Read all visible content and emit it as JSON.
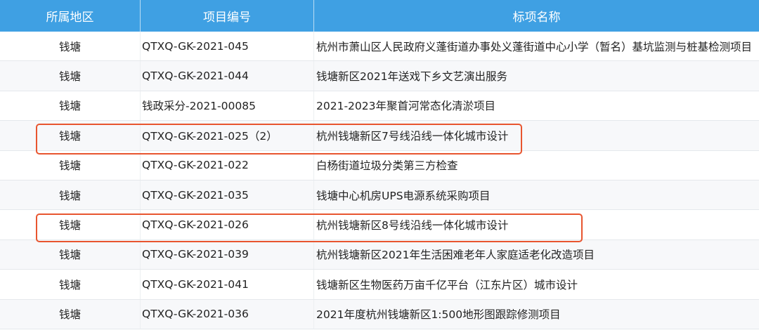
{
  "headers": {
    "region": "所属地区",
    "code": "项目编号",
    "name": "标项名称"
  },
  "rows": [
    {
      "region": "钱塘",
      "code": "QTXQ-GK-2021-045",
      "name": "杭州市萧山区人民政府义蓬街道办事处义蓬街道中心小学（暂名）基坑监测与桩基检测项目"
    },
    {
      "region": "钱塘",
      "code": "QTXQ-GK-2021-044",
      "name": "钱塘新区2021年送戏下乡文艺演出服务"
    },
    {
      "region": "钱塘",
      "code": "钱政采分-2021-00085",
      "name": "2021-2023年聚首河常态化清淤项目"
    },
    {
      "region": "钱塘",
      "code": "QTXQ-GK-2021-025（2）",
      "name": "杭州钱塘新区7号线沿线一体化城市设计",
      "highlighted": true
    },
    {
      "region": "钱塘",
      "code": "QTXQ-GK-2021-022",
      "name": "白杨街道垃圾分类第三方检查"
    },
    {
      "region": "钱塘",
      "code": "QTXQ-GK-2021-035",
      "name": "钱塘中心机房UPS电源系统采购项目"
    },
    {
      "region": "钱塘",
      "code": "QTXQ-GK-2021-026",
      "name": "杭州钱塘新区8号线沿线一体化城市设计",
      "highlighted": true
    },
    {
      "region": "钱塘",
      "code": "QTXQ-GK-2021-039",
      "name": "杭州钱塘新区2021年生活困难老年人家庭适老化改造项目"
    },
    {
      "region": "钱塘",
      "code": "QTXQ-GK-2021-041",
      "name": "钱塘新区生物医药万亩千亿平台（江东片区）城市设计"
    },
    {
      "region": "钱塘",
      "code": "QTXQ-GK-2021-036",
      "name": "2021年度杭州钱塘新区1:500地形图跟踪修测项目"
    }
  ],
  "colors": {
    "header_bg": "#3fa0e3",
    "highlight_border": "#e8552f"
  }
}
